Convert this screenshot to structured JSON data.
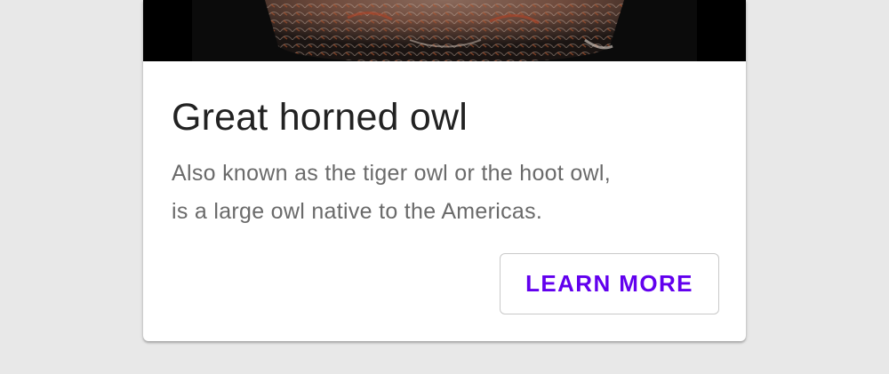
{
  "card": {
    "title": "Great horned owl",
    "body_lines": [
      "Also known as the tiger owl or the hoot owl,",
      "is a large owl native to the Americas."
    ],
    "action_label": "LEARN MORE"
  },
  "colors": {
    "page_background": "#e8e8e8",
    "card_background": "#ffffff",
    "title_text": "#222222",
    "body_text": "#6a6a6a",
    "accent": "#6200ee",
    "button_border": "#c9c9c9"
  }
}
